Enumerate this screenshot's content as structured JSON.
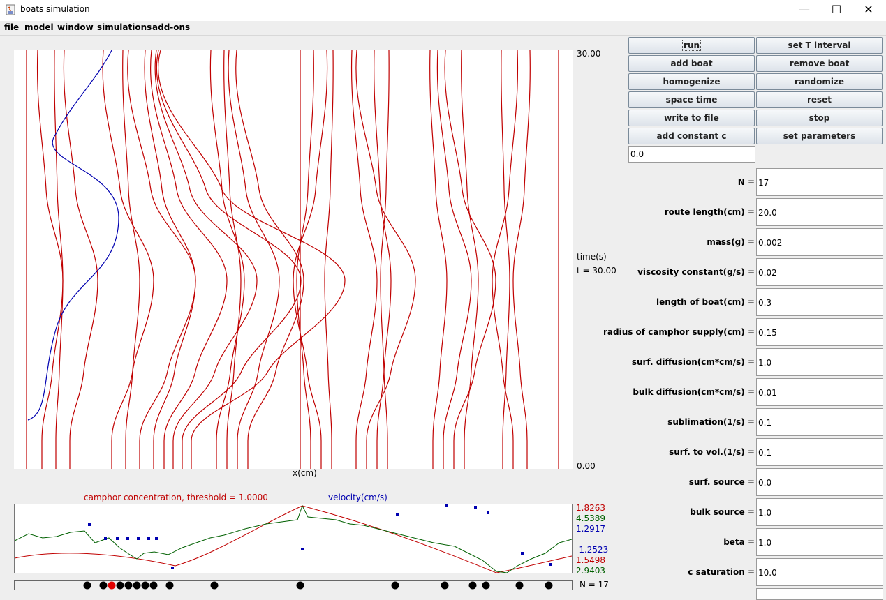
{
  "window": {
    "title": "boats simulation",
    "controls": {
      "minimize": "—",
      "maximize": "☐",
      "close": "✕"
    }
  },
  "menu": [
    "file",
    "model",
    "window",
    "simulations",
    "add-ons"
  ],
  "plot": {
    "y_top_label": "30.00",
    "y_bottom_label": "0.00",
    "time_label": "time(s)",
    "t_label": "t = 30.00",
    "x_label": "x(cm)",
    "trajectory_colors": {
      "red": "#c00000",
      "blue": "#0000b0"
    }
  },
  "lower_plot": {
    "legend_camphor": "camphor concentration, threshold = 1.0000",
    "legend_velocity": "velocity(cm/s)",
    "values": [
      {
        "text": "1.8263",
        "color": "#c00000"
      },
      {
        "text": "4.5389",
        "color": "#006000"
      },
      {
        "text": "1.2917",
        "color": "#0000b0"
      },
      {
        "text": "-1.2523",
        "color": "#0000b0"
      },
      {
        "text": "1.5498",
        "color": "#c00000"
      },
      {
        "text": "2.9403",
        "color": "#006000"
      }
    ],
    "n_label": "N = 17"
  },
  "buttons": [
    [
      "run",
      "set T interval"
    ],
    [
      "add boat",
      "remove boat"
    ],
    [
      "homogenize",
      "randomize"
    ],
    [
      "space time",
      "reset"
    ],
    [
      "write to file",
      "stop"
    ],
    [
      "add constant c",
      "set parameters"
    ]
  ],
  "constant_input": "0.0",
  "parameters": [
    {
      "label": "N =",
      "value": "17"
    },
    {
      "label": "route length(cm) =",
      "value": "20.0"
    },
    {
      "label": "mass(g) =",
      "value": "0.002"
    },
    {
      "label": "viscosity constant(g/s) =",
      "value": "0.02"
    },
    {
      "label": "length of boat(cm) =",
      "value": "0.3"
    },
    {
      "label": "radius of camphor supply(cm) =",
      "value": "0.15"
    },
    {
      "label": "surf. diffusion(cm*cm/s) =",
      "value": "1.0"
    },
    {
      "label": "bulk diffusion(cm*cm/s) =",
      "value": "0.01"
    },
    {
      "label": "sublimation(1/s) =",
      "value": "0.1"
    },
    {
      "label": "surf. to vol.(1/s) =",
      "value": "0.1"
    },
    {
      "label": "surf. source =",
      "value": "0.0"
    },
    {
      "label": "bulk source =",
      "value": "1.0"
    },
    {
      "label": "beta =",
      "value": "1.0"
    },
    {
      "label": "c saturation =",
      "value": "10.0"
    }
  ]
}
